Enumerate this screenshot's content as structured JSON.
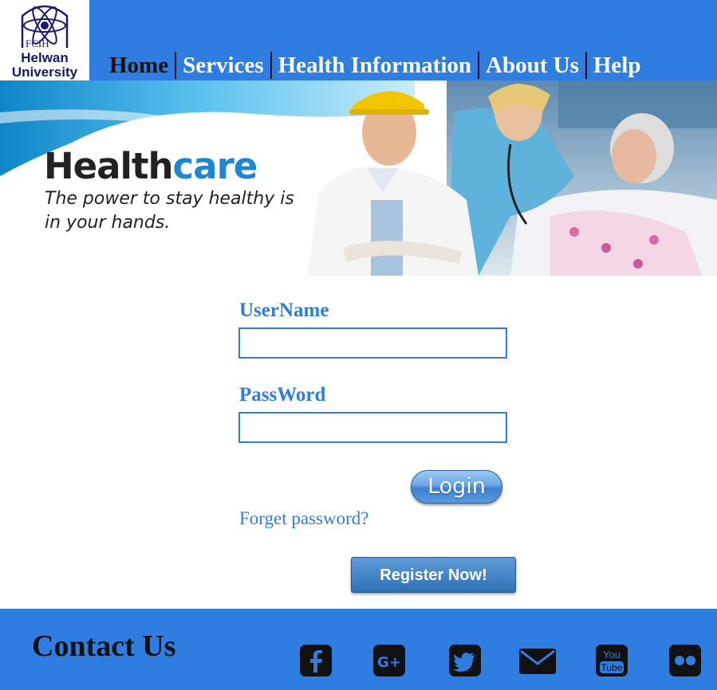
{
  "header": {
    "logo": {
      "small_text": "FCIH",
      "line1": "Helwan",
      "line2": "University"
    },
    "nav": [
      {
        "label": "Home"
      },
      {
        "label": "Services"
      },
      {
        "label": "Health Information"
      },
      {
        "label": "About Us"
      },
      {
        "label": "Help"
      }
    ]
  },
  "banner": {
    "title_part1": "Health",
    "title_part2": "care",
    "tagline_line1": "The power to stay healthy is",
    "tagline_line2": "in your hands."
  },
  "form": {
    "username_label": "UserName",
    "username_value": "",
    "password_label": "PassWord",
    "password_value": "",
    "login_label": "Login",
    "forget_label": "Forget password?",
    "register_label": "Register Now!"
  },
  "footer": {
    "title": "Contact Us",
    "social_icons": [
      "facebook-icon",
      "google-plus-icon",
      "twitter-icon",
      "mail-icon",
      "youtube-icon",
      "flickr-icon"
    ]
  },
  "colors": {
    "brand_blue": "#2f7de1",
    "text_dark": "#111111",
    "white": "#ffffff"
  }
}
